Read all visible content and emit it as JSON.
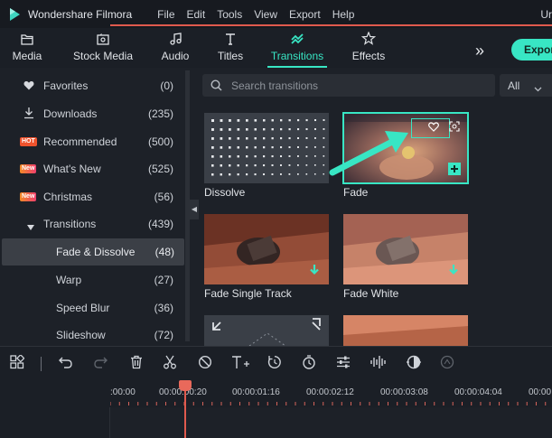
{
  "menubar": {
    "app_name": "Wondershare Filmora",
    "items": [
      "File",
      "Edit",
      "Tools",
      "View",
      "Export",
      "Help"
    ],
    "right_text": "Ur"
  },
  "tabs": [
    {
      "label": "Media",
      "icon": "folder-icon"
    },
    {
      "label": "Stock Media",
      "icon": "stock-media-icon"
    },
    {
      "label": "Audio",
      "icon": "music-note-icon"
    },
    {
      "label": "Titles",
      "icon": "text-t-icon"
    },
    {
      "label": "Transitions",
      "icon": "transitions-icon",
      "active": true
    },
    {
      "label": "Effects",
      "icon": "effects-star-icon"
    }
  ],
  "more_icon": "double-chevron-right-icon",
  "export_label": "Expor",
  "sidebar": {
    "items": [
      {
        "label": "Favorites",
        "count": "(0)",
        "icon": "heart-icon"
      },
      {
        "label": "Downloads",
        "count": "(235)",
        "icon": "download-icon"
      },
      {
        "label": "Recommended",
        "count": "(500)",
        "badge": "HOT"
      },
      {
        "label": "What's New",
        "count": "(525)",
        "badge": "New"
      },
      {
        "label": "Christmas",
        "count": "(56)",
        "badge": "New"
      },
      {
        "label": "Transitions",
        "count": "(439)",
        "icon": "caret-down-icon"
      },
      {
        "label": "Fade & Dissolve",
        "count": "(48)",
        "selected": true
      },
      {
        "label": "Warp",
        "count": "(27)"
      },
      {
        "label": "Speed Blur",
        "count": "(36)"
      },
      {
        "label": "Slideshow",
        "count": "(72)"
      }
    ]
  },
  "search": {
    "placeholder": "Search transitions",
    "filter_value": "All"
  },
  "cards": [
    {
      "label": "Dissolve"
    },
    {
      "label": "Fade",
      "selected": true
    },
    {
      "label": "Fade Single Track"
    },
    {
      "label": "Fade White"
    },
    {
      "label": ""
    },
    {
      "label": ""
    }
  ],
  "timeline": {
    "toolbar_icons": [
      "layout-grid-icon",
      "undo-icon",
      "redo-icon",
      "delete-icon",
      "cut-icon",
      "disable-icon",
      "add-text-icon",
      "rotate-icon",
      "timer-icon",
      "adjust-icon",
      "audio-waveform-icon",
      "color-match-icon",
      "speed-icon"
    ],
    "ruler_labels": [
      ":00:00",
      "00:00:00:20",
      "00:00:01:16",
      "00:00:02:12",
      "00:00:03:08",
      "00:00:04:04",
      "00:00"
    ]
  },
  "colors": {
    "accent": "#38e6c4",
    "playhead": "#e9695b",
    "hot_badge": "#f0532d"
  }
}
